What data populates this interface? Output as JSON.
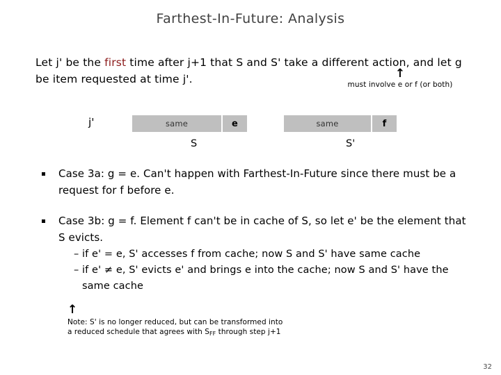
{
  "slide": {
    "title": "Farthest-In-Future:  Analysis",
    "page_number": "32",
    "title_color": "#404040",
    "accent_color": "#8b1a1a",
    "box_fill_color": "#bfbfbf"
  },
  "intro": {
    "part1": "Let j' be the ",
    "highlight": "first",
    "part2": " time after j+1 that S and S' take a different action, and let g be item requested at time j'."
  },
  "annotation_top": {
    "arrow": "↑",
    "text": "must involve e or f (or both)"
  },
  "diagram": {
    "time_label": "j'",
    "left_bar": {
      "same_label": "same",
      "item_label": "e",
      "schedule_label": "S"
    },
    "right_bar": {
      "same_label": "same",
      "item_label": "f",
      "schedule_label": "S'"
    }
  },
  "bullets": [
    {
      "marker": "square",
      "text": "Case 3a:  g = e.  Can't happen with Farthest-In-Future since there must be a request for f before e."
    },
    {
      "marker": "square",
      "text": "Case 3b:  g = f.  Element f can't be in cache of S, so let e' be the element that S evicts.",
      "sub_items": [
        {
          "dash": "–",
          "text": "if e' = e, S' accesses f from cache; now S and S' have same cache"
        },
        {
          "dash": "–",
          "text": "if e' ≠ e, S' evicts e' and brings e into the cache; now S and S' have the same cache"
        }
      ]
    }
  ],
  "note_bottom": {
    "arrow": "↑",
    "line1_a": "Note:  S' is no longer reduced, but can be transformed into",
    "line2_a": "a reduced schedule that agrees with S",
    "line2_sub": "FF",
    "line2_b": " through step j+1"
  }
}
